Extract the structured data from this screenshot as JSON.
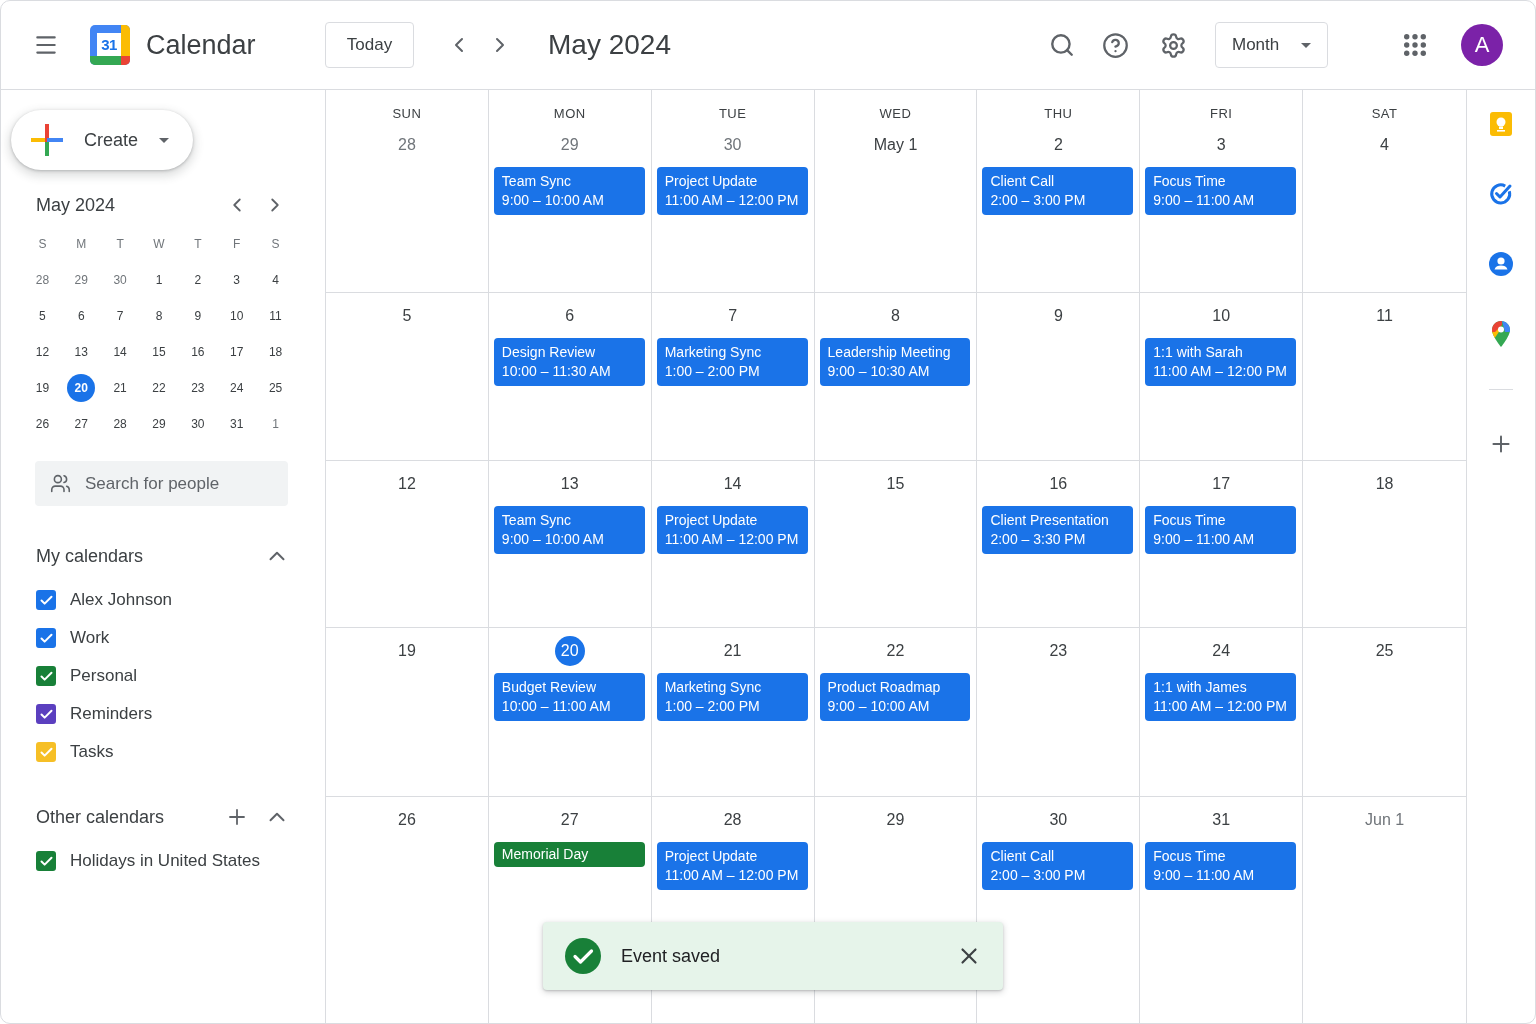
{
  "app": {
    "logo_text": "31",
    "title": "Calendar"
  },
  "toolbar": {
    "today_button": "Today",
    "period_title": "May 2024",
    "view_selector": "Month",
    "avatar_initial": "A"
  },
  "sidebar": {
    "create_button": "Create",
    "mini_calendar": {
      "title": "May 2024",
      "weekdays": [
        "S",
        "M",
        "T",
        "W",
        "T",
        "F",
        "S"
      ],
      "weeks": [
        [
          {
            "day": "28",
            "outside": true,
            "selected": false
          },
          {
            "day": "29",
            "outside": true,
            "selected": false
          },
          {
            "day": "30",
            "outside": true,
            "selected": false
          },
          {
            "day": "1",
            "outside": false,
            "selected": false
          },
          {
            "day": "2",
            "outside": false,
            "selected": false
          },
          {
            "day": "3",
            "outside": false,
            "selected": false
          },
          {
            "day": "4",
            "outside": false,
            "selected": false
          }
        ],
        [
          {
            "day": "5",
            "outside": false,
            "selected": false
          },
          {
            "day": "6",
            "outside": false,
            "selected": false
          },
          {
            "day": "7",
            "outside": false,
            "selected": false
          },
          {
            "day": "8",
            "outside": false,
            "selected": false
          },
          {
            "day": "9",
            "outside": false,
            "selected": false
          },
          {
            "day": "10",
            "outside": false,
            "selected": false
          },
          {
            "day": "11",
            "outside": false,
            "selected": false
          }
        ],
        [
          {
            "day": "12",
            "outside": false,
            "selected": false
          },
          {
            "day": "13",
            "outside": false,
            "selected": false
          },
          {
            "day": "14",
            "outside": false,
            "selected": false
          },
          {
            "day": "15",
            "outside": false,
            "selected": false
          },
          {
            "day": "16",
            "outside": false,
            "selected": false
          },
          {
            "day": "17",
            "outside": false,
            "selected": false
          },
          {
            "day": "18",
            "outside": false,
            "selected": false
          }
        ],
        [
          {
            "day": "19",
            "outside": false,
            "selected": false
          },
          {
            "day": "20",
            "outside": false,
            "selected": true
          },
          {
            "day": "21",
            "outside": false,
            "selected": false
          },
          {
            "day": "22",
            "outside": false,
            "selected": false
          },
          {
            "day": "23",
            "outside": false,
            "selected": false
          },
          {
            "day": "24",
            "outside": false,
            "selected": false
          },
          {
            "day": "25",
            "outside": false,
            "selected": false
          }
        ],
        [
          {
            "day": "26",
            "outside": false,
            "selected": false
          },
          {
            "day": "27",
            "outside": false,
            "selected": false
          },
          {
            "day": "28",
            "outside": false,
            "selected": false
          },
          {
            "day": "29",
            "outside": false,
            "selected": false
          },
          {
            "day": "30",
            "outside": false,
            "selected": false
          },
          {
            "day": "31",
            "outside": false,
            "selected": false
          },
          {
            "day": "1",
            "outside": true,
            "selected": false
          }
        ]
      ]
    },
    "people_search": {
      "placeholder": "Search for people"
    },
    "calendar_groups": [
      {
        "title": "My calendars",
        "expanded": true,
        "add_button": false,
        "items": [
          {
            "label": "Alex Johnson",
            "checked": true,
            "color": "#1a73e8"
          },
          {
            "label": "Work",
            "checked": true,
            "color": "#1a73e8"
          },
          {
            "label": "Personal",
            "checked": true,
            "color": "#188038"
          },
          {
            "label": "Reminders",
            "checked": true,
            "color": "#5b3fbf"
          },
          {
            "label": "Tasks",
            "checked": true,
            "color": "#f6bf26"
          }
        ]
      },
      {
        "title": "Other calendars",
        "expanded": true,
        "add_button": true,
        "items": [
          {
            "label": "Holidays in United States",
            "checked": true,
            "color": "#188038"
          }
        ]
      }
    ]
  },
  "month_grid": {
    "weekdays": [
      "SUN",
      "MON",
      "TUE",
      "WED",
      "THU",
      "FRI",
      "SAT"
    ],
    "weeks": [
      [
        {
          "date": "28",
          "outside": true,
          "today": false
        },
        {
          "date": "29",
          "outside": true,
          "today": false,
          "events": [
            {
              "title": "Team Sync",
              "time": "9:00 – 10:00 AM",
              "color": "#1a73e8"
            }
          ]
        },
        {
          "date": "30",
          "outside": true,
          "today": false,
          "events": [
            {
              "title": "Project Update",
              "time": "11:00 AM – 12:00 PM",
              "color": "#1a73e8"
            }
          ]
        },
        {
          "date": "May 1",
          "outside": false,
          "today": false
        },
        {
          "date": "2",
          "outside": false,
          "today": false,
          "events": [
            {
              "title": "Client Call",
              "time": "2:00 – 3:00 PM",
              "color": "#1a73e8"
            }
          ]
        },
        {
          "date": "3",
          "outside": false,
          "today": false,
          "events": [
            {
              "title": "Focus Time",
              "time": "9:00 – 11:00 AM",
              "color": "#1a73e8"
            }
          ]
        },
        {
          "date": "4",
          "outside": false,
          "today": false
        }
      ],
      [
        {
          "date": "5",
          "outside": false,
          "today": false
        },
        {
          "date": "6",
          "outside": false,
          "today": false,
          "events": [
            {
              "title": "Design Review",
              "time": "10:00 – 11:30 AM",
              "color": "#1a73e8"
            }
          ]
        },
        {
          "date": "7",
          "outside": false,
          "today": false,
          "events": [
            {
              "title": "Marketing Sync",
              "time": "1:00 – 2:00 PM",
              "color": "#1a73e8"
            }
          ]
        },
        {
          "date": "8",
          "outside": false,
          "today": false,
          "events": [
            {
              "title": "Leadership Meeting",
              "time": "9:00 – 10:30 AM",
              "color": "#1a73e8"
            }
          ]
        },
        {
          "date": "9",
          "outside": false,
          "today": false
        },
        {
          "date": "10",
          "outside": false,
          "today": false,
          "events": [
            {
              "title": "1:1 with Sarah",
              "time": "11:00 AM – 12:00 PM",
              "color": "#1a73e8"
            }
          ]
        },
        {
          "date": "11",
          "outside": false,
          "today": false
        }
      ],
      [
        {
          "date": "12",
          "outside": false,
          "today": false
        },
        {
          "date": "13",
          "outside": false,
          "today": false,
          "events": [
            {
              "title": "Team Sync",
              "time": "9:00 – 10:00 AM",
              "color": "#1a73e8"
            }
          ]
        },
        {
          "date": "14",
          "outside": false,
          "today": false,
          "events": [
            {
              "title": "Project Update",
              "time": "11:00 AM – 12:00 PM",
              "color": "#1a73e8"
            }
          ]
        },
        {
          "date": "15",
          "outside": false,
          "today": false
        },
        {
          "date": "16",
          "outside": false,
          "today": false,
          "events": [
            {
              "title": "Client Presentation",
              "time": "2:00 – 3:30 PM",
              "color": "#1a73e8"
            }
          ]
        },
        {
          "date": "17",
          "outside": false,
          "today": false,
          "events": [
            {
              "title": "Focus Time",
              "time": "9:00 – 11:00 AM",
              "color": "#1a73e8"
            }
          ]
        },
        {
          "date": "18",
          "outside": false,
          "today": false
        }
      ],
      [
        {
          "date": "19",
          "outside": false,
          "today": false
        },
        {
          "date": "20",
          "outside": false,
          "today": true,
          "events": [
            {
              "title": "Budget Review",
              "time": "10:00 – 11:00 AM",
              "color": "#1a73e8"
            }
          ]
        },
        {
          "date": "21",
          "outside": false,
          "today": false,
          "events": [
            {
              "title": "Marketing Sync",
              "time": "1:00 – 2:00 PM",
              "color": "#1a73e8"
            }
          ]
        },
        {
          "date": "22",
          "outside": false,
          "today": false,
          "events": [
            {
              "title": "Product Roadmap",
              "time": "9:00 – 10:00 AM",
              "color": "#1a73e8"
            }
          ]
        },
        {
          "date": "23",
          "outside": false,
          "today": false
        },
        {
          "date": "24",
          "outside": false,
          "today": false,
          "events": [
            {
              "title": "1:1 with James",
              "time": "11:00 AM – 12:00 PM",
              "color": "#1a73e8"
            }
          ]
        },
        {
          "date": "25",
          "outside": false,
          "today": false
        }
      ],
      [
        {
          "date": "26",
          "outside": false,
          "today": false
        },
        {
          "date": "27",
          "outside": false,
          "today": false,
          "events": [
            {
              "title": "Memorial Day",
              "color": "#188038"
            }
          ]
        },
        {
          "date": "28",
          "outside": false,
          "today": false,
          "events": [
            {
              "title": "Project Update",
              "time": "11:00 AM – 12:00 PM",
              "color": "#1a73e8"
            }
          ]
        },
        {
          "date": "29",
          "outside": false,
          "today": false
        },
        {
          "date": "30",
          "outside": false,
          "today": false,
          "events": [
            {
              "title": "Client Call",
              "time": "2:00 – 3:00 PM",
              "color": "#1a73e8"
            }
          ]
        },
        {
          "date": "31",
          "outside": false,
          "today": false,
          "events": [
            {
              "title": "Focus Time",
              "time": "9:00 – 11:00 AM",
              "color": "#1a73e8"
            }
          ]
        },
        {
          "date": "Jun 1",
          "outside": true,
          "today": false
        }
      ]
    ]
  },
  "toast": {
    "message": "Event saved"
  }
}
